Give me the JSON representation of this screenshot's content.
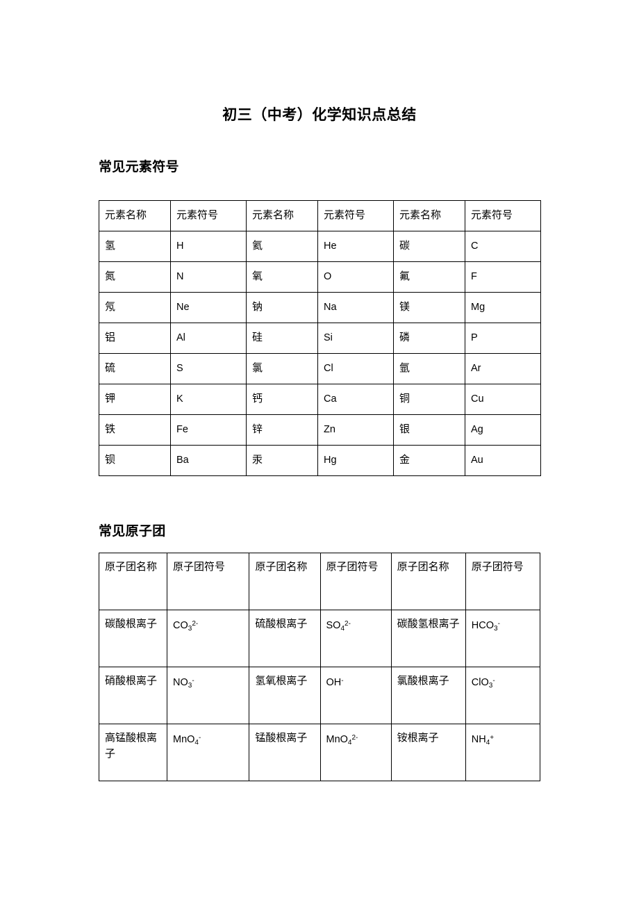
{
  "document": {
    "title": "初三（中考）化学知识点总结"
  },
  "sections": {
    "elements": {
      "heading": "常见元素符号",
      "headers": [
        "元素名称",
        "元素符号",
        "元素名称",
        "元素符号",
        "元素名称",
        "元素符号"
      ],
      "rows": [
        {
          "n1": "氢",
          "s1": "H",
          "n2": "氦",
          "s2": "He",
          "n3": "碳",
          "s3": "C"
        },
        {
          "n1": "氮",
          "s1": "N",
          "n2": "氧",
          "s2": "O",
          "n3": "氟",
          "s3": "F"
        },
        {
          "n1": "氖",
          "s1": "Ne",
          "n2": "钠",
          "s2": "Na",
          "n3": "镁",
          "s3": "Mg"
        },
        {
          "n1": "铝",
          "s1": "Al",
          "n2": "硅",
          "s2": "Si",
          "n3": "磷",
          "s3": "P"
        },
        {
          "n1": "硫",
          "s1": "S",
          "n2": "氯",
          "s2": "Cl",
          "n3": "氩",
          "s3": "Ar"
        },
        {
          "n1": "钾",
          "s1": "K",
          "n2": "钙",
          "s2": "Ca",
          "n3": "铜",
          "s3": "Cu"
        },
        {
          "n1": "铁",
          "s1": "Fe",
          "n2": "锌",
          "s2": "Zn",
          "n3": "银",
          "s3": "Ag"
        },
        {
          "n1": "钡",
          "s1": "Ba",
          "n2": "汞",
          "s2": "Hg",
          "n3": "金",
          "s3": "Au"
        }
      ]
    },
    "radicals": {
      "heading": "常见原子团",
      "headers": [
        "原子团名称",
        "原子团符号",
        "原子团名称",
        "原子团符号",
        "原子团名称",
        "原子团符号"
      ],
      "rows": [
        {
          "n1": "碳酸根离子",
          "s1": {
            "base": "CO",
            "sub": "3",
            "sup": "2-"
          },
          "n2": "硫酸根离子",
          "s2": {
            "base": "SO",
            "sub": "4",
            "sup": "2-"
          },
          "n3": "碳酸氢根离子",
          "s3": {
            "base": "HCO",
            "sub": "3",
            "sup": "-"
          }
        },
        {
          "n1": "硝酸根离子",
          "s1": {
            "base": "NO",
            "sub": "3",
            "sup": "-"
          },
          "n2": "氢氧根离子",
          "s2": {
            "base": "OH",
            "sub": "",
            "sup": "-"
          },
          "n3": "氯酸根离子",
          "s3": {
            "base": "ClO",
            "sub": "3",
            "sup": "-"
          }
        },
        {
          "n1": "高锰酸根离子",
          "s1": {
            "base": "MnO",
            "sub": "4",
            "sup": "-"
          },
          "n2": "锰酸根离子",
          "s2": {
            "base": "MnO",
            "sub": "4",
            "sup": "2-"
          },
          "n3": "铵根离子",
          "s3": {
            "base": "NH",
            "sub": "4",
            "sup": "+"
          }
        }
      ]
    }
  }
}
